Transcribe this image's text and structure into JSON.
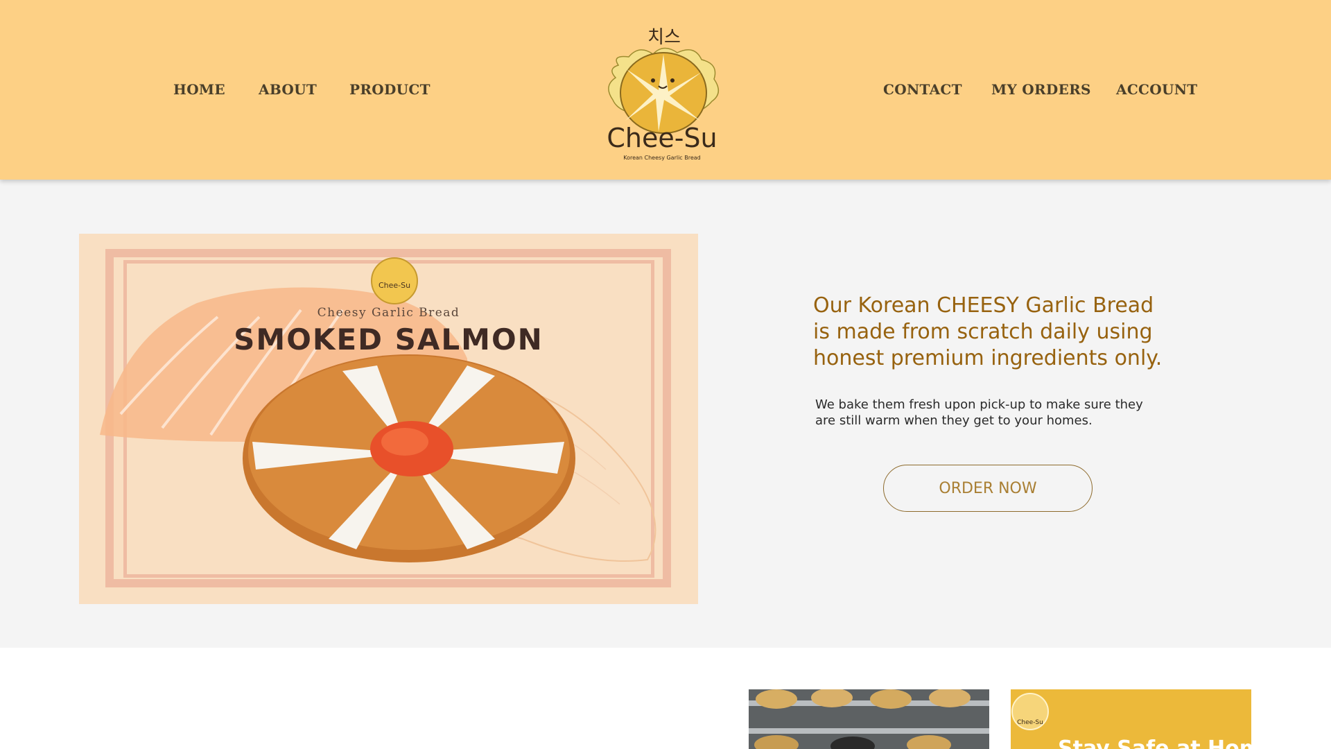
{
  "nav": {
    "left": [
      "HOME",
      "ABOUT",
      "PRODUCT"
    ],
    "right": [
      "CONTACT",
      "MY ORDERS",
      "ACCOUNT"
    ]
  },
  "logo": {
    "korean": "치스",
    "brand": "Chee-Su",
    "tagline": "Korean Cheesy Garlic Bread"
  },
  "hero": {
    "image": {
      "logo_text": "Chee-Su",
      "subtitle": "Cheesy Garlic Bread",
      "title": "SMOKED SALMON"
    },
    "heading": "Our Korean CHEESY Garlic Bread is made from scratch daily using honest premium ingredients only.",
    "subtext": "We bake them fresh upon pick-up to make sure they are still warm when they get to your homes.",
    "cta": "ORDER NOW"
  },
  "promo": {
    "logo_text": "Chee-Su",
    "banner_text": "Stay Safe at Home"
  },
  "colors": {
    "header_bg": "#fdd085",
    "accent": "#97620f",
    "page_bg": "#f4f4f4"
  }
}
